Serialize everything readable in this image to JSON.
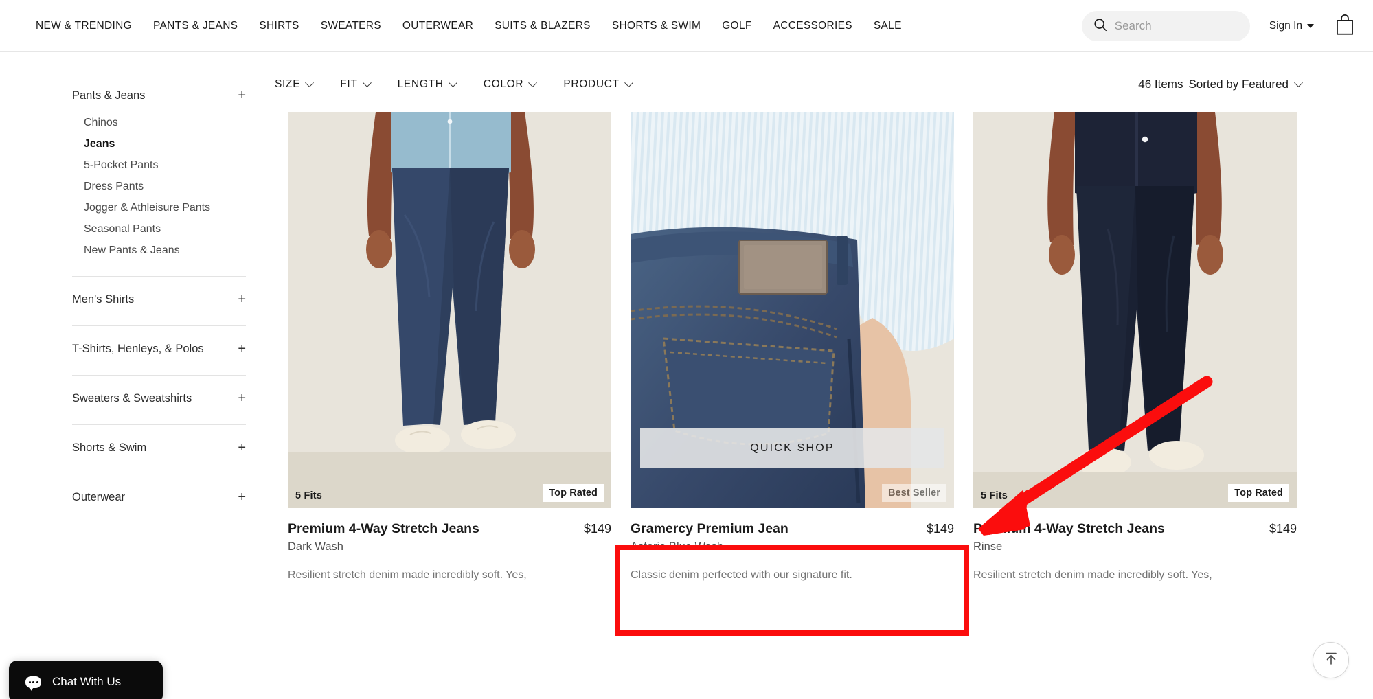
{
  "header": {
    "nav_items": [
      {
        "label": "NEW & TRENDING",
        "name": "nav-new-trending"
      },
      {
        "label": "PANTS & JEANS",
        "name": "nav-pants-jeans"
      },
      {
        "label": "SHIRTS",
        "name": "nav-shirts"
      },
      {
        "label": "SWEATERS",
        "name": "nav-sweaters"
      },
      {
        "label": "OUTERWEAR",
        "name": "nav-outerwear"
      },
      {
        "label": "SUITS & BLAZERS",
        "name": "nav-suits-blazers"
      },
      {
        "label": "SHORTS & SWIM",
        "name": "nav-shorts-swim"
      },
      {
        "label": "GOLF",
        "name": "nav-golf"
      },
      {
        "label": "ACCESSORIES",
        "name": "nav-accessories"
      },
      {
        "label": "SALE",
        "name": "nav-sale"
      }
    ],
    "search": {
      "placeholder": "Search",
      "value": "",
      "icon": "search-icon"
    },
    "sign_in": {
      "label": "Sign In",
      "icon": "chevron-down-icon"
    },
    "bag": {
      "icon": "shopping-bag-icon"
    }
  },
  "sidebar": {
    "groups": [
      {
        "label": "Pants & Jeans",
        "name": "sidebar-group-pants-jeans",
        "expander": "+",
        "expanded": true,
        "items": [
          {
            "label": "Chinos",
            "name": "sidebar-item-chinos",
            "active": false
          },
          {
            "label": "Jeans",
            "name": "sidebar-item-jeans",
            "active": true
          },
          {
            "label": "5-Pocket Pants",
            "name": "sidebar-item-5-pocket-pants",
            "active": false
          },
          {
            "label": "Dress Pants",
            "name": "sidebar-item-dress-pants",
            "active": false
          },
          {
            "label": "Jogger & Athleisure Pants",
            "name": "sidebar-item-jogger-athleisure-pants",
            "active": false
          },
          {
            "label": "Seasonal Pants",
            "name": "sidebar-item-seasonal-pants",
            "active": false
          },
          {
            "label": "New Pants & Jeans",
            "name": "sidebar-item-new-pants-jeans",
            "active": false
          }
        ]
      },
      {
        "label": "Men's Shirts",
        "name": "sidebar-group-mens-shirts",
        "expander": "+",
        "expanded": false,
        "items": []
      },
      {
        "label": "T-Shirts, Henleys, & Polos",
        "name": "sidebar-group-tshirts-henleys-polos",
        "expander": "+",
        "expanded": false,
        "items": []
      },
      {
        "label": "Sweaters & Sweatshirts",
        "name": "sidebar-group-sweaters-sweatshirts",
        "expander": "+",
        "expanded": false,
        "items": []
      },
      {
        "label": "Shorts & Swim",
        "name": "sidebar-group-shorts-swim",
        "expander": "+",
        "expanded": false,
        "items": []
      },
      {
        "label": "Outerwear",
        "name": "sidebar-group-outerwear",
        "expander": "+",
        "expanded": false,
        "items": []
      }
    ]
  },
  "filterbar": {
    "filters": [
      {
        "label": "SIZE",
        "name": "filter-size"
      },
      {
        "label": "FIT",
        "name": "filter-fit"
      },
      {
        "label": "LENGTH",
        "name": "filter-length"
      },
      {
        "label": "COLOR",
        "name": "filter-color"
      },
      {
        "label": "PRODUCT",
        "name": "filter-product"
      }
    ],
    "item_count": "46 Items",
    "sort_label": "Sorted by Featured"
  },
  "products": [
    {
      "title": "Premium 4-Way Stretch Jeans",
      "price": "$149",
      "color": "Dark Wash",
      "description": "Resilient stretch denim made incredibly soft. Yes,",
      "fits_badge": "5 Fits",
      "tag_badge": "Top Rated",
      "quick_shop": null
    },
    {
      "title": "Gramercy Premium Jean",
      "price": "$149",
      "color": "Astoria Blue Wash",
      "description": "Classic denim perfected with our signature fit.",
      "fits_badge": null,
      "tag_badge": "Best Seller",
      "quick_shop": "QUICK SHOP"
    },
    {
      "title": "Premium 4-Way Stretch Jeans",
      "price": "$149",
      "color": "Rinse",
      "description": "Resilient stretch denim made incredibly soft. Yes,",
      "fits_badge": "5 Fits",
      "tag_badge": "Top Rated",
      "quick_shop": null
    }
  ],
  "floating": {
    "chat_label": "Chat With Us",
    "chat_icon": "chat-bubble-icon",
    "back_to_top_icon": "arrow-up-icon"
  },
  "annotations": {
    "highlight_color": "#fb0d0d",
    "box_target": "quick-shop-button",
    "arrow_target": "product-card-3-image"
  }
}
